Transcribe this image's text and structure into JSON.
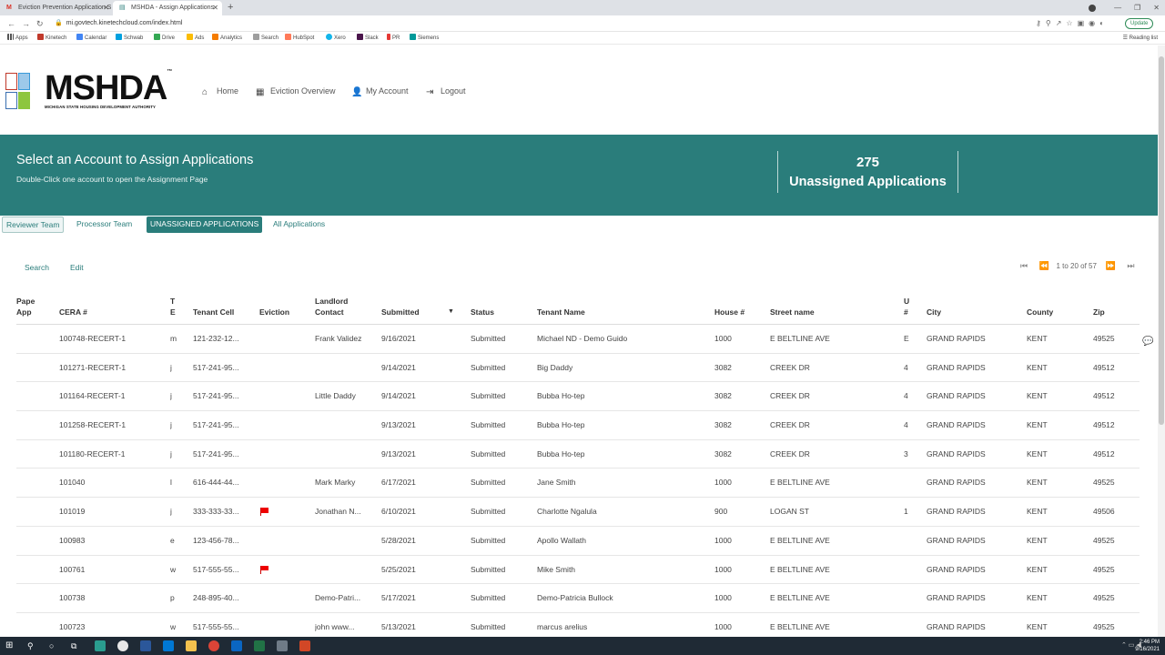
{
  "browser": {
    "tabs": [
      {
        "title": "Eviction Prevention Application S",
        "active": false,
        "favicon": "gmail-icon"
      },
      {
        "title": "MSHDA - Assign Applications",
        "active": true,
        "favicon": "site-icon"
      }
    ],
    "url": "mi.govtech.kinetechcloud.com/index.html",
    "update_label": "Update",
    "bookmarks": [
      "Apps",
      "Kinetech",
      "Calendar",
      "Schwab",
      "Drive",
      "Ads",
      "Analytics",
      "Search",
      "HubSpot",
      "Xero",
      "Slack",
      "PR",
      "Siemens"
    ],
    "reading_list": "Reading list"
  },
  "header": {
    "logo_text": "MSHDA",
    "logo_tm": "™",
    "logo_subtitle": "MICHIGAN STATE HOUSING DEVELOPMENT AUTHORITY",
    "nav": [
      {
        "label": "Home",
        "icon": "home-icon"
      },
      {
        "label": "Eviction Overview",
        "icon": "grid-icon"
      },
      {
        "label": "My Account",
        "icon": "user-icon"
      },
      {
        "label": "Logout",
        "icon": "logout-icon"
      }
    ]
  },
  "banner": {
    "title": "Select an Account to Assign Applications",
    "subtitle": "Double-Click one account to open the Assignment Page",
    "count": "275",
    "count_label": "Unassigned Applications",
    "color": "#2a7d7b"
  },
  "tabs": [
    "Reviewer Team",
    "Processor Team",
    "UNASSIGNED APPLICATIONS",
    "All Applications"
  ],
  "toolbar": {
    "search_label": "Search",
    "edit_label": "Edit",
    "pager_text": "1 to 20 of 57"
  },
  "table": {
    "columns": [
      {
        "l1": "Paper",
        "l2": "App"
      },
      {
        "l1": "",
        "l2": "CERA #"
      },
      {
        "l1": "T",
        "l2": "E"
      },
      {
        "l1": "",
        "l2": "Tenant Cell"
      },
      {
        "l1": "",
        "l2": "Eviction"
      },
      {
        "l1": "Landlord",
        "l2": "Contact"
      },
      {
        "l1": "",
        "l2": "Submitted"
      },
      {
        "l1": "",
        "l2": "Status"
      },
      {
        "l1": "",
        "l2": "Tenant Name"
      },
      {
        "l1": "",
        "l2": "House #"
      },
      {
        "l1": "",
        "l2": "Street name"
      },
      {
        "l1": "U",
        "l2": "#"
      },
      {
        "l1": "",
        "l2": "City"
      },
      {
        "l1": "",
        "l2": "County"
      },
      {
        "l1": "",
        "l2": "Zip"
      }
    ],
    "sort_indicator": "▼",
    "rows": [
      {
        "cera": "100748-RECERT-1",
        "te": "m",
        "cell": "121-232-12...",
        "flag": false,
        "landlord": "Frank Validez",
        "submitted": "9/16/2021",
        "status": "Submitted",
        "tenant": "Michael ND - Demo Guido",
        "house": "1000",
        "street": "E BELTLINE AVE",
        "unit": "E",
        "city": "GRAND RAPIDS",
        "county": "KENT",
        "zip": "49525"
      },
      {
        "cera": "101271-RECERT-1",
        "te": "j",
        "cell": "517-241-95...",
        "flag": false,
        "landlord": "",
        "submitted": "9/14/2021",
        "status": "Submitted",
        "tenant": "Big Daddy",
        "house": "3082",
        "street": "CREEK DR",
        "unit": "4",
        "city": "GRAND RAPIDS",
        "county": "KENT",
        "zip": "49512"
      },
      {
        "cera": "101164-RECERT-1",
        "te": "j",
        "cell": "517-241-95...",
        "flag": false,
        "landlord": "Little Daddy",
        "submitted": "9/14/2021",
        "status": "Submitted",
        "tenant": "Bubba Ho-tep",
        "house": "3082",
        "street": "CREEK DR",
        "unit": "4",
        "city": "GRAND RAPIDS",
        "county": "KENT",
        "zip": "49512"
      },
      {
        "cera": "101258-RECERT-1",
        "te": "j",
        "cell": "517-241-95...",
        "flag": false,
        "landlord": "",
        "submitted": "9/13/2021",
        "status": "Submitted",
        "tenant": "Bubba Ho-tep",
        "house": "3082",
        "street": "CREEK DR",
        "unit": "4",
        "city": "GRAND RAPIDS",
        "county": "KENT",
        "zip": "49512"
      },
      {
        "cera": "101180-RECERT-1",
        "te": "j",
        "cell": "517-241-95...",
        "flag": false,
        "landlord": "",
        "submitted": "9/13/2021",
        "status": "Submitted",
        "tenant": "Bubba Ho-tep",
        "house": "3082",
        "street": "CREEK DR",
        "unit": "3",
        "city": "GRAND RAPIDS",
        "county": "KENT",
        "zip": "49512"
      },
      {
        "cera": "101040",
        "te": "l",
        "cell": "616-444-44...",
        "flag": false,
        "landlord": "Mark Marky",
        "submitted": "6/17/2021",
        "status": "Submitted",
        "tenant": "Jane Smith",
        "house": "1000",
        "street": "E BELTLINE AVE",
        "unit": "",
        "city": "GRAND RAPIDS",
        "county": "KENT",
        "zip": "49525"
      },
      {
        "cera": "101019",
        "te": "j",
        "cell": "333-333-33...",
        "flag": true,
        "landlord": "Jonathan N...",
        "submitted": "6/10/2021",
        "status": "Submitted",
        "tenant": "Charlotte Ngalula",
        "house": "900",
        "street": "LOGAN ST",
        "unit": "1",
        "city": "GRAND RAPIDS",
        "county": "KENT",
        "zip": "49506"
      },
      {
        "cera": "100983",
        "te": "e",
        "cell": "123-456-78...",
        "flag": false,
        "landlord": "",
        "submitted": "5/28/2021",
        "status": "Submitted",
        "tenant": "Apollo Wallath",
        "house": "1000",
        "street": "E BELTLINE AVE",
        "unit": "",
        "city": "GRAND RAPIDS",
        "county": "KENT",
        "zip": "49525"
      },
      {
        "cera": "100761",
        "te": "w",
        "cell": "517-555-55...",
        "flag": true,
        "landlord": "",
        "submitted": "5/25/2021",
        "status": "Submitted",
        "tenant": "Mike Smith",
        "house": "1000",
        "street": "E BELTLINE AVE",
        "unit": "",
        "city": "GRAND RAPIDS",
        "county": "KENT",
        "zip": "49525"
      },
      {
        "cera": "100738",
        "te": "p",
        "cell": "248-895-40...",
        "flag": false,
        "landlord": "Demo-Patri...",
        "submitted": "5/17/2021",
        "status": "Submitted",
        "tenant": "Demo-Patricia Bullock",
        "house": "1000",
        "street": "E BELTLINE AVE",
        "unit": "",
        "city": "GRAND RAPIDS",
        "county": "KENT",
        "zip": "49525"
      },
      {
        "cera": "100723",
        "te": "w",
        "cell": "517-555-55...",
        "flag": false,
        "landlord": "john www...",
        "submitted": "5/13/2021",
        "status": "Submitted",
        "tenant": "marcus arelius",
        "house": "1000",
        "street": "E BELTLINE AVE",
        "unit": "",
        "city": "GRAND RAPIDS",
        "county": "KENT",
        "zip": "49525"
      }
    ]
  },
  "taskbar": {
    "clock_time": "2:46 PM",
    "clock_date": "9/16/2021"
  }
}
